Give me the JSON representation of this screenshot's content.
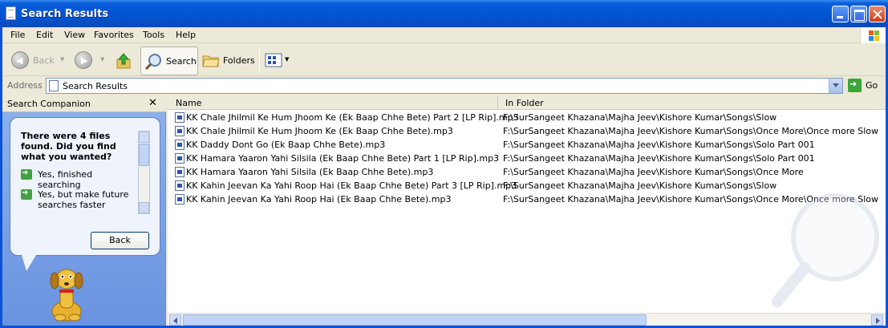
{
  "window": {
    "title": "Search Results"
  },
  "menu": [
    "File",
    "Edit",
    "View",
    "Favorites",
    "Tools",
    "Help"
  ],
  "toolbar": {
    "back": "Back",
    "search": "Search",
    "folders": "Folders"
  },
  "address": {
    "label": "Address",
    "value": "Search Results",
    "go": "Go"
  },
  "companion": {
    "title": "Search Companion",
    "close": "✕",
    "question": "There were 4 files found. Did you find what you wanted?",
    "options": [
      "Yes, finished searching",
      "Yes, but make future searches faster"
    ],
    "back": "Back"
  },
  "results": {
    "columns": [
      "Name",
      "In Folder"
    ],
    "rows": [
      {
        "name": "KK Chale Jhilmil Ke Hum Jhoom Ke (Ek Baap Chhe Bete) Part 2 [LP Rip].mp3",
        "folder": "F:\\SurSangeet Khazana\\Majha Jeev\\Kishore Kumar\\Songs\\Slow"
      },
      {
        "name": "KK Chale Jhilmil Ke Hum Jhoom Ke (Ek Baap Chhe Bete).mp3",
        "folder": "F:\\SurSangeet Khazana\\Majha Jeev\\Kishore Kumar\\Songs\\Once More\\Once more Slow"
      },
      {
        "name": "KK Daddy Dont Go (Ek Baap Chhe Bete).mp3",
        "folder": "F:\\SurSangeet Khazana\\Majha Jeev\\Kishore Kumar\\Songs\\Solo Part 001"
      },
      {
        "name": "KK Hamara Yaaron Yahi Silsila (Ek Baap Chhe Bete) Part 1 [LP Rip].mp3",
        "folder": "F:\\SurSangeet Khazana\\Majha Jeev\\Kishore Kumar\\Songs\\Solo Part 001"
      },
      {
        "name": "KK Hamara Yaaron Yahi Silsila (Ek Baap Chhe Bete).mp3",
        "folder": "F:\\SurSangeet Khazana\\Majha Jeev\\Kishore Kumar\\Songs\\Once More"
      },
      {
        "name": "KK Kahin Jeevan Ka Yahi Roop Hai (Ek Baap Chhe Bete) Part 3 [LP Rip].mp3",
        "folder": "F:\\SurSangeet Khazana\\Majha Jeev\\Kishore Kumar\\Songs\\Slow"
      },
      {
        "name": "KK Kahin Jeevan Ka Yahi Roop Hai (Ek Baap Chhe Bete).mp3",
        "folder": "F:\\SurSangeet Khazana\\Majha Jeev\\Kishore Kumar\\Songs\\Once More\\Once more Slow"
      }
    ]
  },
  "colors": {
    "titlebar": "#0456d6",
    "panel": "#7ba2e7",
    "chrome": "#ece9d8"
  }
}
